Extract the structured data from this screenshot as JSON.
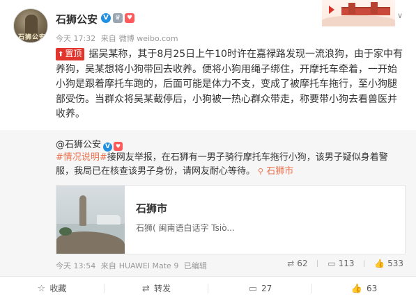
{
  "post": {
    "username": "石狮公安",
    "verified_mark": "V",
    "time": "今天 17:32",
    "source_prefix": "来自",
    "source": "微博 weibo.com",
    "pin_label": "置顶",
    "text": "据吴某称，其于8月25日上午10时许在嘉禄路发现一流浪狗，由于家中有养狗，吴某想将小狗带回去收养。便将小狗用绳子绑住，开摩托车牵着，一开始小狗是跟着摩托车跑的，后面可能是体力不支，变成了被摩托车拖行，至小狗腿部受伤。当群众将吴某截停后，小狗被一热心群众带走，称要带小狗去看兽医并收养。"
  },
  "repost": {
    "at_user": "@石狮公安",
    "topic": "#情况说明#",
    "text": "接网友举报，在石狮有一男子骑行摩托车拖行小狗，该男子疑似身着警服，我局已在核查该男子身份，请网友耐心等待。",
    "location": "石狮市",
    "card_title": "石狮市",
    "card_subtitle": "石狮( 闽南语白话字 Tsiò...",
    "time": "今天 13:54",
    "source_prefix": "来自",
    "source": "HUAWEI Mate 9",
    "edited": "已编辑",
    "reposts": "62",
    "comments": "113",
    "likes": "533"
  },
  "actions": {
    "favorite": "收藏",
    "repost": "转发",
    "comment": "27",
    "like": "63"
  },
  "colors": {
    "accent_orange": "#eb7350",
    "pin_red": "#e0362d",
    "verified_blue": "#1e8fe1"
  }
}
